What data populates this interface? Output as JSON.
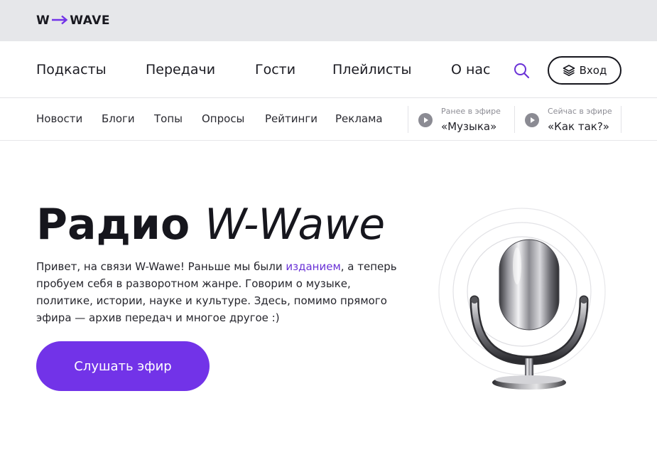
{
  "brand": {
    "logo_left": "W",
    "logo_right": "WAVE",
    "accent": "#7233e8",
    "topbar_bg": "#e6e7ea"
  },
  "main_nav": {
    "items": [
      "Подкасты",
      "Передачи",
      "Гости",
      "Плейлисты",
      "О нас"
    ],
    "search_icon": "search-icon",
    "login_icon": "layers-icon",
    "login_label": "Вход"
  },
  "sub_nav": {
    "items": [
      "Новости",
      "Блоги",
      "Топы",
      "Опросы",
      "Рейтинги",
      "Реклама"
    ],
    "previously": {
      "caption": "Ранее в эфире",
      "title": "«Музыка»"
    },
    "now": {
      "caption": "Сейчас в эфире",
      "title": "«Как так?»"
    }
  },
  "hero": {
    "title_bold": "Радио",
    "title_italic": "W-Wawe",
    "text_before": "Привет, на связи W-Wawe! Раньше мы были ",
    "text_link": "изданием",
    "text_after": ", а теперь пробуем себя в разворотном жанре. Говорим о музыке, политике, истории, науке и культуре. Здесь, помимо прямого эфира — архив передач и многое другое :)",
    "cta_label": "Слушать эфир",
    "illustration_icon": "microphone-icon"
  }
}
